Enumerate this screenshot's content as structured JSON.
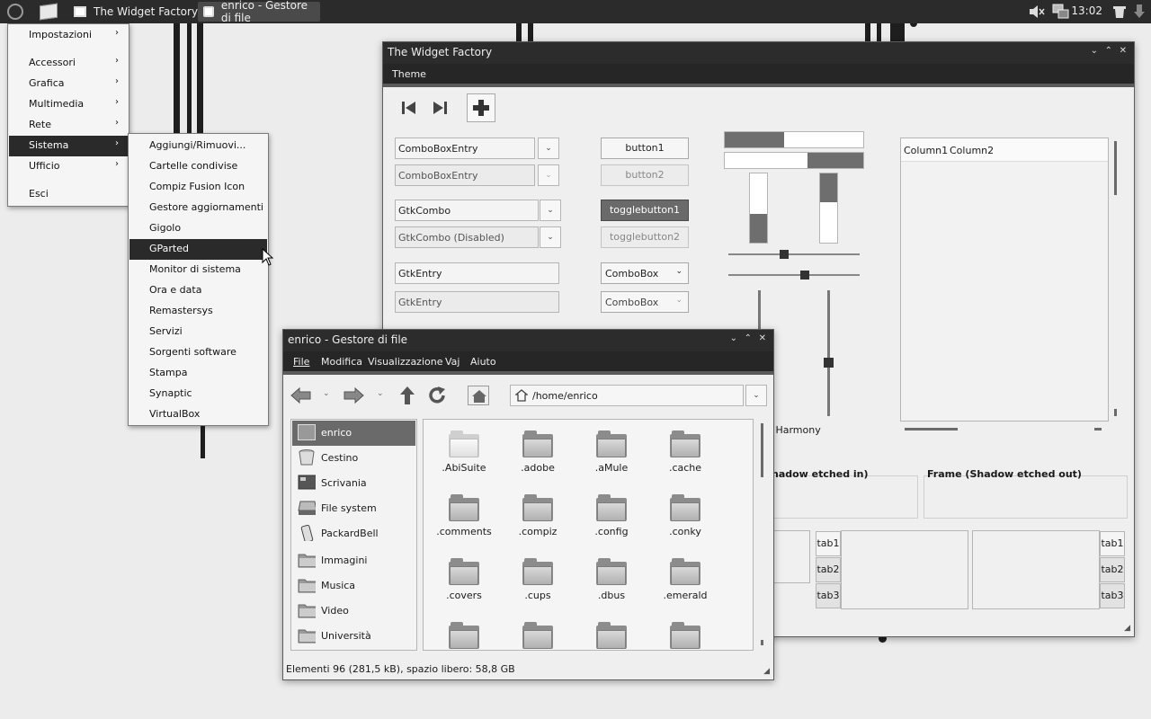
{
  "panel": {
    "tasks": [
      "The Widget Factory",
      "enrico - Gestore di file"
    ],
    "clock": "13:02"
  },
  "main_menu": {
    "items": [
      "Impostazioni",
      "Accessori",
      "Grafica",
      "Multimedia",
      "Rete",
      "Sistema",
      "Ufficio",
      "Esci"
    ],
    "selected": "Sistema"
  },
  "sistema_menu": {
    "items": [
      "Aggiungi/Rimuovi...",
      "Cartelle condivise",
      "Compiz Fusion Icon",
      "Gestore aggiornamenti",
      "Gigolo",
      "GParted",
      "Monitor di sistema",
      "Ora e data",
      "Remastersys",
      "Servizi",
      "Sorgenti software",
      "Stampa",
      "Synaptic",
      "VirtualBox"
    ],
    "selected": "GParted"
  },
  "widget_factory": {
    "title": "The Widget Factory",
    "menu": [
      "Theme"
    ],
    "combo_entries": [
      "ComboBoxEntry",
      "ComboBoxEntry"
    ],
    "gtk_combos": [
      "GtkCombo",
      "GtkCombo (Disabled)"
    ],
    "entries": [
      "GtkEntry",
      "GtkEntry"
    ],
    "buttons": [
      "button1",
      "button2"
    ],
    "toggles": [
      "togglebutton1",
      "togglebutton2"
    ],
    "comboboxes": [
      "ComboBox",
      "ComboBox"
    ],
    "progress_h": [
      0.43,
      0.4
    ],
    "progress_v": [
      0.42,
      0.42
    ],
    "columns": [
      "Column1",
      "Column2"
    ],
    "harmony_label": "n Harmony",
    "frame_in": "hadow etched in)",
    "frame_out": "Frame (Shadow etched out)",
    "tabs_left": [
      "tab1",
      "tab2",
      "tab3"
    ],
    "tabs_right": [
      "tab1",
      "tab2",
      "tab3"
    ]
  },
  "file_manager": {
    "title": "enrico - Gestore di file",
    "menu": [
      "File",
      "Modifica",
      "Visualizzazione",
      "Vaj",
      "Aiuto"
    ],
    "path": "/home/enrico",
    "places": [
      "enrico",
      "Cestino",
      "Scrivania",
      "File system",
      "PackardBell",
      "Immagini",
      "Musica",
      "Video",
      "Università"
    ],
    "selected_place": "enrico",
    "files": [
      ".AbiSuite",
      ".adobe",
      ".aMule",
      ".cache",
      ".comments",
      ".compiz",
      ".config",
      ".conky",
      ".covers",
      ".cups",
      ".dbus",
      ".emerald"
    ],
    "status": "Elementi 96 (281,5 kB), spazio libero: 58,8 GB"
  }
}
